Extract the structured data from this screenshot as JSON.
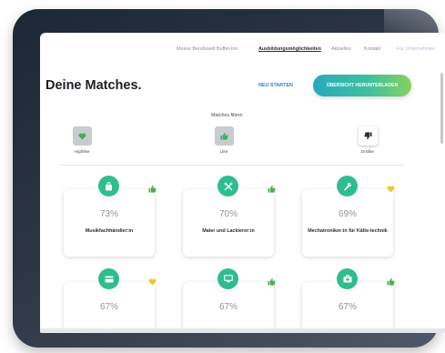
{
  "nav": {
    "items": [
      {
        "label": "Messe Berufswelt Buffet-Inn",
        "state": "normal"
      },
      {
        "label": "Ausbildungsmöglichkeiten",
        "state": "active"
      },
      {
        "label": "Aktuelles",
        "state": "normal"
      },
      {
        "label": "Kontakt",
        "state": "normal"
      },
      {
        "label": "Für Unternehmen",
        "state": "muted"
      }
    ]
  },
  "header": {
    "title": "Deine Matches.",
    "restart_label": "NEU STARTEN",
    "download_label": "ÜBERSICHT HERUNTERLADEN"
  },
  "filters": {
    "label": "Matches filtern",
    "items": [
      {
        "label": "Highlike",
        "icon": "heart-icon"
      },
      {
        "label": "Like",
        "icon": "thumbs-up-icon"
      },
      {
        "label": "Dislike",
        "icon": "thumbs-down-icon"
      }
    ]
  },
  "matches": [
    {
      "percent": "73%",
      "name": "Musikfachhändler:in",
      "icon": "bag-icon",
      "reaction": "like"
    },
    {
      "percent": "70%",
      "name": "Maler und Lackierer:in",
      "icon": "tools-icon",
      "reaction": "like"
    },
    {
      "percent": "69%",
      "name": "Mechatroniker:in für Kälte-technik",
      "icon": "wrench-icon",
      "reaction": "highlike"
    },
    {
      "percent": "67%",
      "name": "",
      "icon": "card-icon",
      "reaction": "highlike"
    },
    {
      "percent": "67%",
      "name": "",
      "icon": "monitor-icon",
      "reaction": "like"
    },
    {
      "percent": "67%",
      "name": "",
      "icon": "medkit-icon",
      "reaction": "like"
    }
  ],
  "colors": {
    "accent_green": "#2fbd8f",
    "like_green": "#4caf50",
    "highlike_yellow": "#f2c72c",
    "link_blue": "#2f7fce"
  }
}
